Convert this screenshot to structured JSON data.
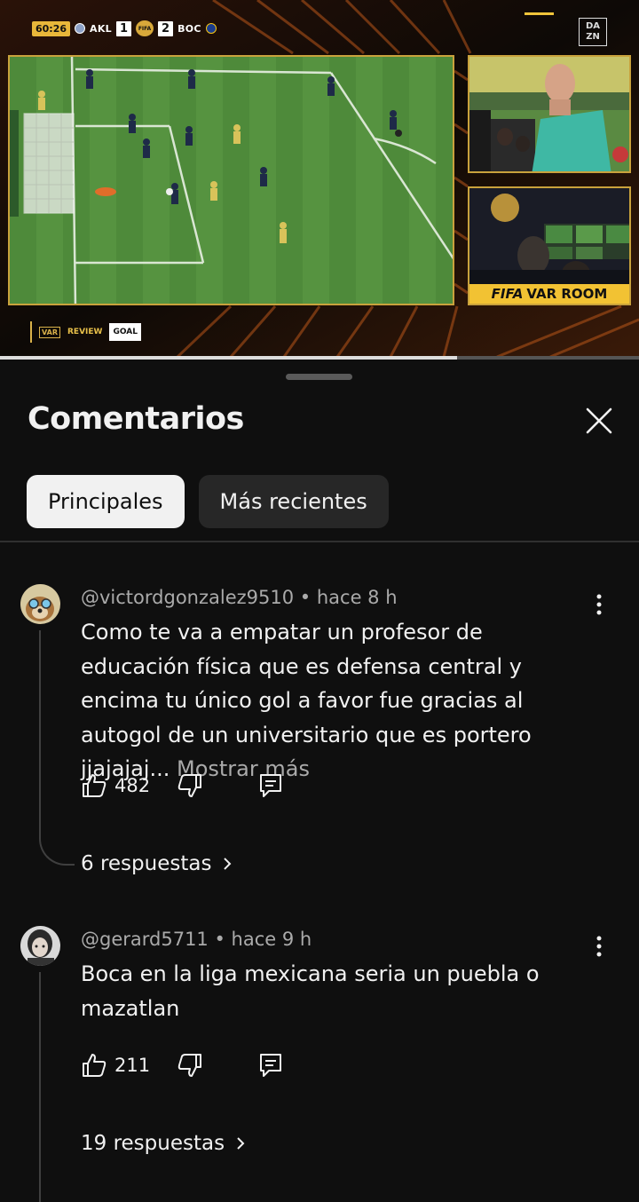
{
  "video": {
    "scoreboard": {
      "time": "60:26",
      "home_team": "AKL",
      "home_score": "1",
      "away_team": "BOC",
      "away_score": "2",
      "competition_badge": "FIFA"
    },
    "broadcaster": "DAZN",
    "var_room_label_brand": "FIFA",
    "var_room_label_text": "VAR ROOM",
    "review_bar": {
      "var_chip": "VAR",
      "review_label": "REVIEW",
      "decision": "GOAL"
    },
    "progress_fraction": 0.715,
    "accent_color": "#f2c233"
  },
  "comments_panel": {
    "title": "Comentarios",
    "close_icon": "close-icon",
    "filters": [
      {
        "label": "Principales",
        "selected": true
      },
      {
        "label": "Más recientes",
        "selected": false
      }
    ],
    "comments": [
      {
        "author": "@victordgonzalez9510",
        "time": "hace 8 h",
        "text": "Como te va a empatar un profesor de educación física que es defensa central y encima tu único gol a favor fue gracias al autogol de un universitario que es portero jjajajaj...",
        "more_label": "Mostrar más",
        "likes": "482",
        "replies_label": "6 respuestas"
      },
      {
        "author": "@gerard5711",
        "time": "hace 9 h",
        "text": "Boca en la liga mexicana seria un puebla o mazatlan",
        "likes": "211",
        "replies_label": "19 respuestas"
      }
    ]
  }
}
